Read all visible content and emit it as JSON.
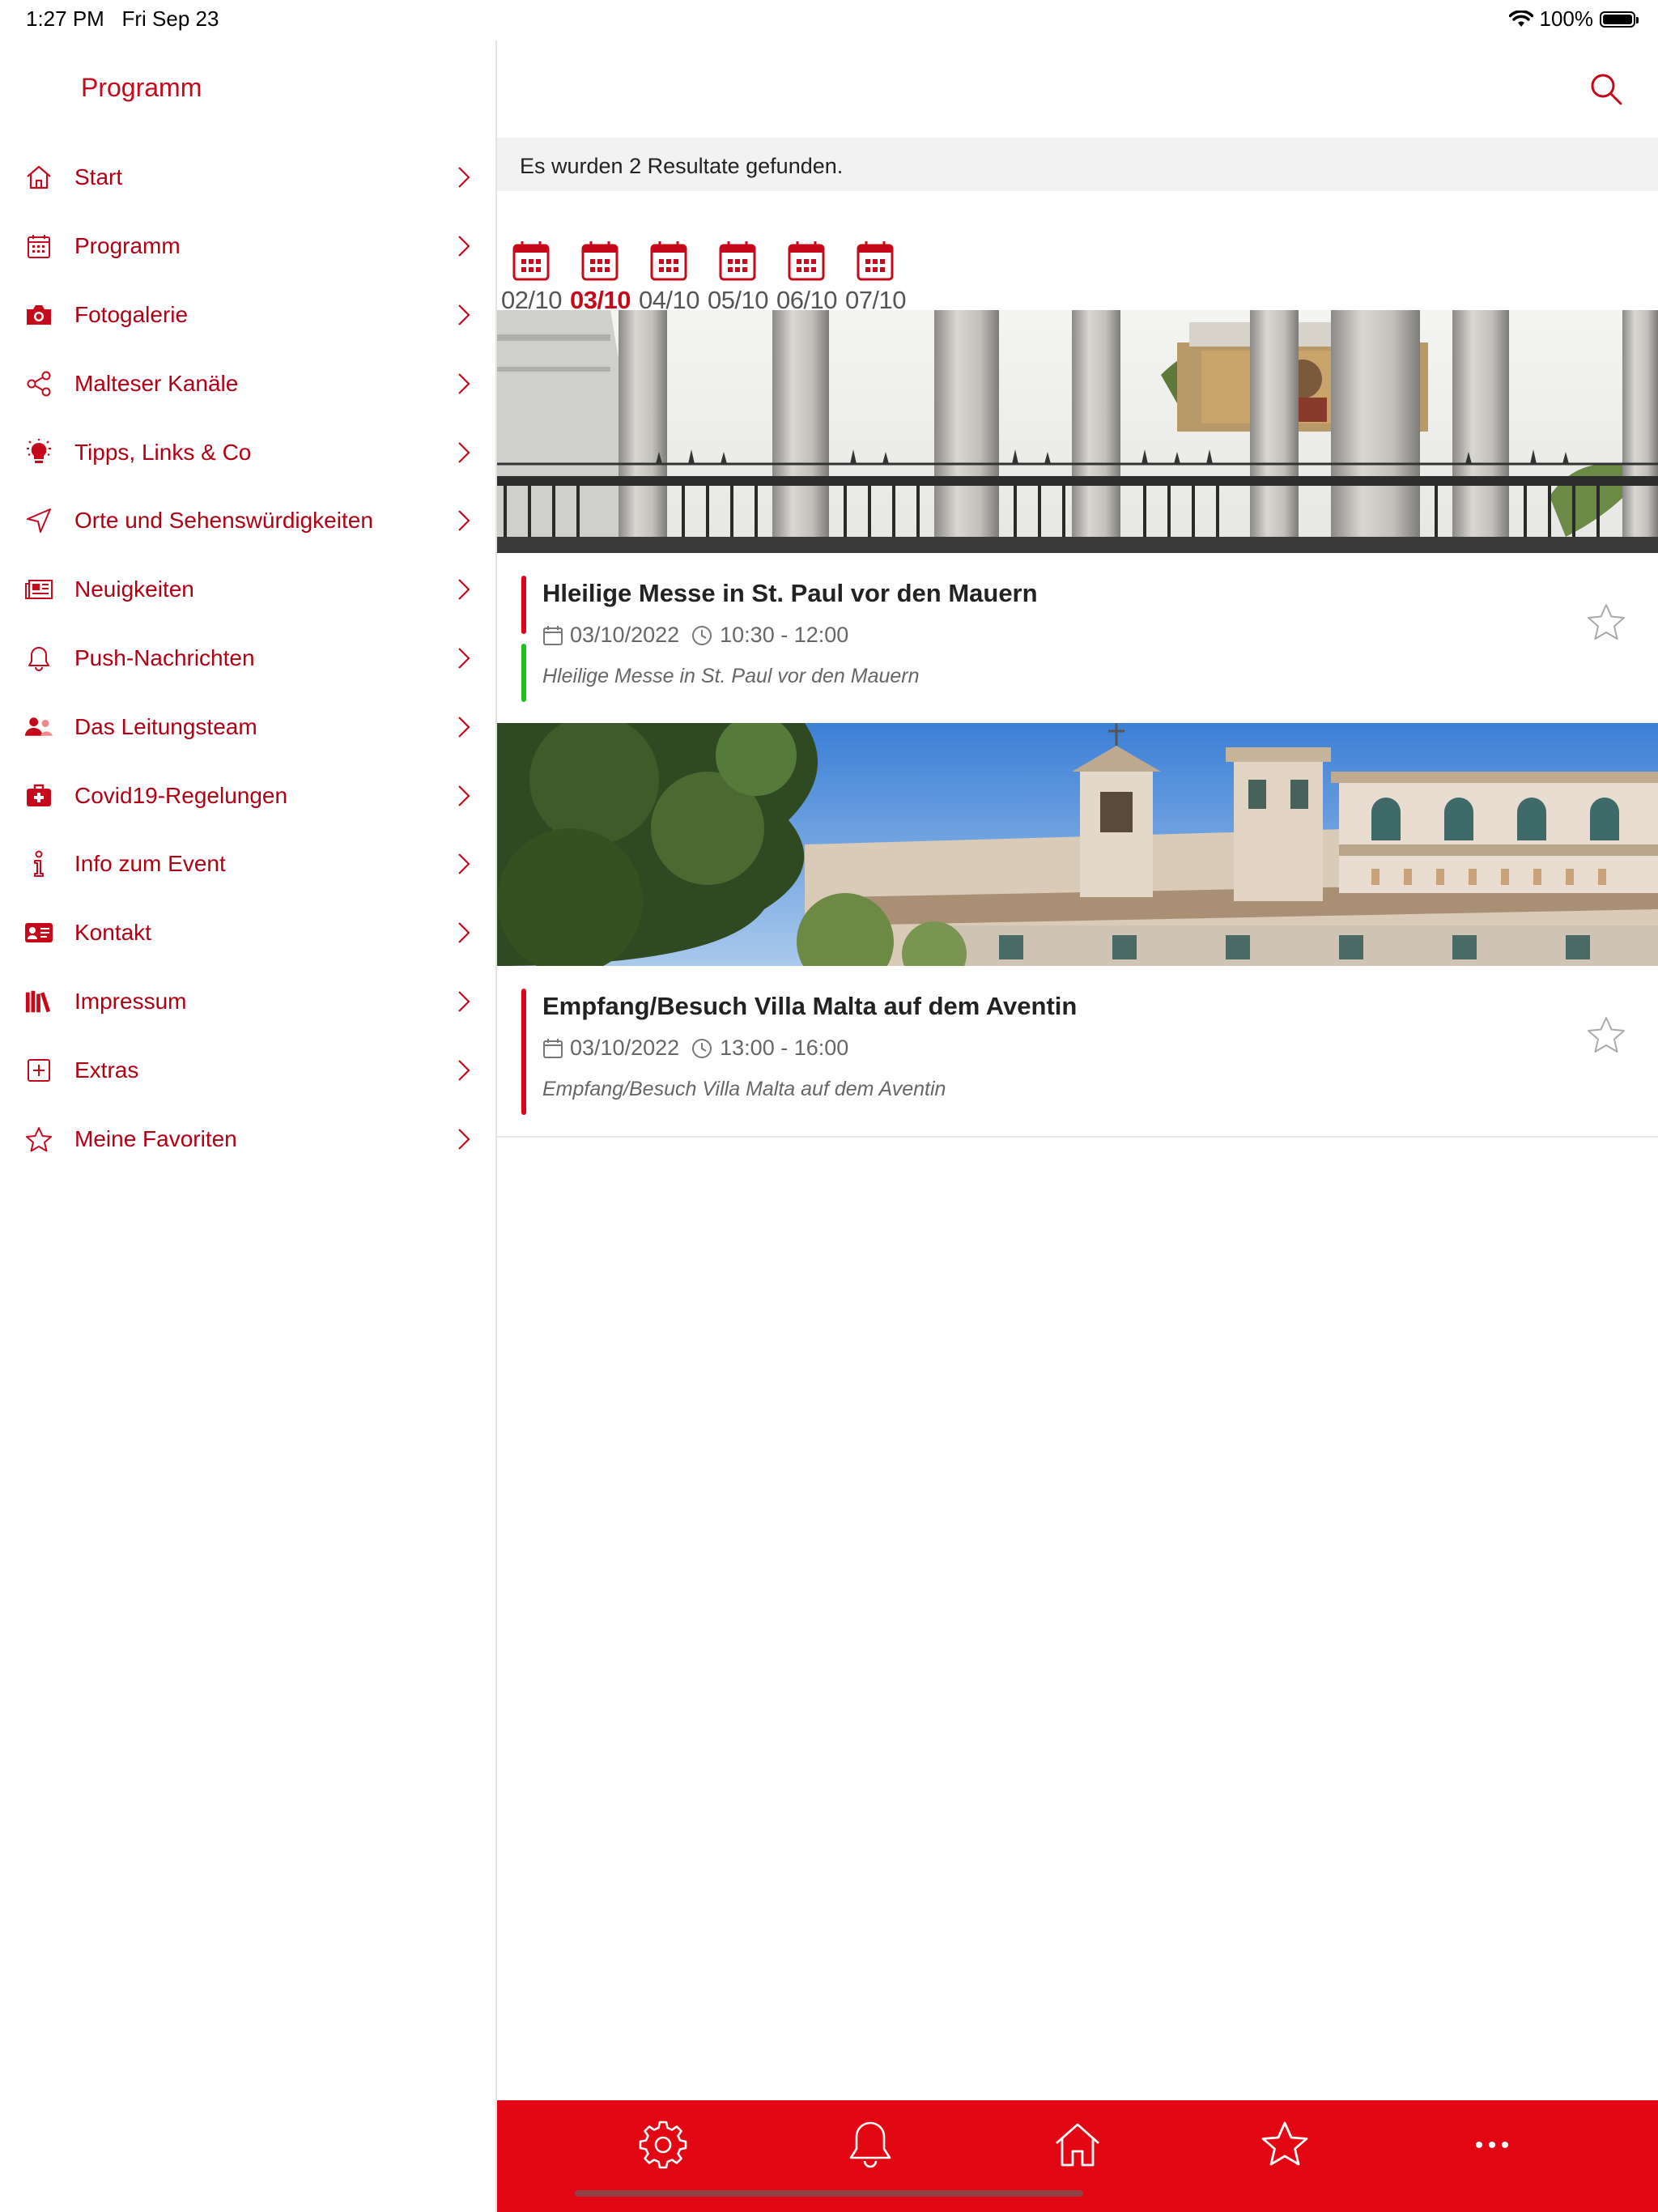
{
  "status_bar": {
    "time": "1:27 PM",
    "date": "Fri Sep 23",
    "battery": "100%"
  },
  "sidebar": {
    "title": "Programm",
    "items": [
      {
        "label": "Start",
        "icon": "home-icon"
      },
      {
        "label": "Programm",
        "icon": "calendar-icon"
      },
      {
        "label": "Fotogalerie",
        "icon": "camera-icon"
      },
      {
        "label": "Malteser Kanäle",
        "icon": "share-icon"
      },
      {
        "label": "Tipps, Links & Co",
        "icon": "lightbulb-icon"
      },
      {
        "label": "Orte und Sehenswürdigkeiten",
        "icon": "location-arrow-icon"
      },
      {
        "label": "Neuigkeiten",
        "icon": "newspaper-icon"
      },
      {
        "label": "Push-Nachrichten",
        "icon": "bell-icon"
      },
      {
        "label": "Das Leitungsteam",
        "icon": "users-icon"
      },
      {
        "label": "Covid19-Regelungen",
        "icon": "medical-kit-icon"
      },
      {
        "label": "Info zum Event",
        "icon": "info-icon"
      },
      {
        "label": "Kontakt",
        "icon": "contact-card-icon"
      },
      {
        "label": "Impressum",
        "icon": "books-icon"
      },
      {
        "label": "Extras",
        "icon": "plus-square-icon"
      },
      {
        "label": "Meine Favoriten",
        "icon": "star-icon"
      }
    ]
  },
  "main": {
    "results_text": "Es wurden 2 Resultate gefunden.",
    "dates": [
      {
        "label": "02/10",
        "active": false
      },
      {
        "label": "03/10",
        "active": true
      },
      {
        "label": "04/10",
        "active": false
      },
      {
        "label": "05/10",
        "active": false
      },
      {
        "label": "06/10",
        "active": false
      },
      {
        "label": "07/10",
        "active": false
      }
    ],
    "events": [
      {
        "title": "Hleilige Messe in St. Paul vor den Mauern",
        "date": "03/10/2022",
        "time": "10:30 - 12:00",
        "subtitle": "Hleilige Messe in St. Paul vor den Mauern",
        "image": "basilica-columns-photo"
      },
      {
        "title": "Empfang/Besuch Villa Malta auf dem Aventin",
        "date": "03/10/2022",
        "time": "13:00 - 16:00",
        "subtitle": "Empfang/Besuch Villa Malta auf dem Aventin",
        "image": "villa-malta-photo"
      }
    ]
  },
  "bottom_nav": [
    {
      "icon": "settings-icon"
    },
    {
      "icon": "bell-icon"
    },
    {
      "icon": "home-icon"
    },
    {
      "icon": "star-icon"
    },
    {
      "icon": "more-icon"
    }
  ],
  "colors": {
    "accent": "#c5091a",
    "bottom_bar": "#e30613",
    "green_marker": "#1ec21e"
  }
}
